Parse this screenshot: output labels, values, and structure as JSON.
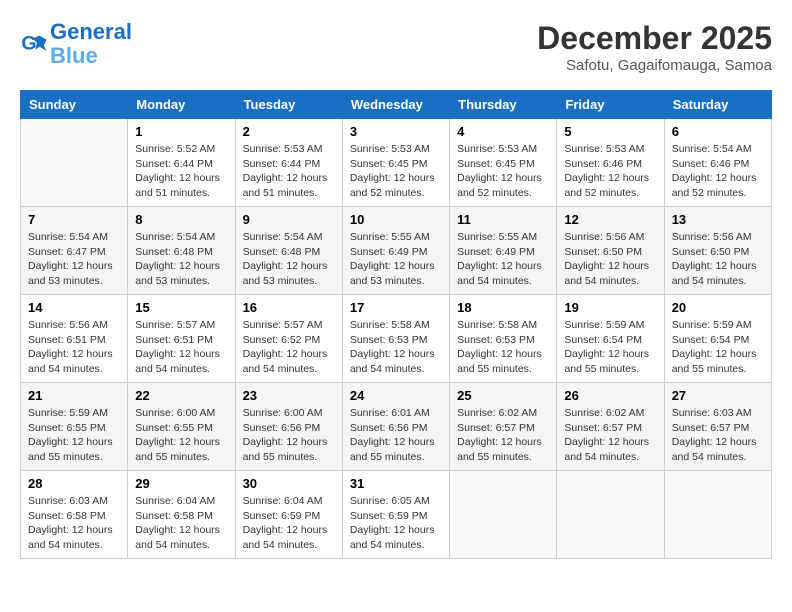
{
  "header": {
    "logo_line1": "General",
    "logo_line2": "Blue",
    "month_title": "December 2025",
    "location": "Safotu, Gagaifomauga, Samoa"
  },
  "weekdays": [
    "Sunday",
    "Monday",
    "Tuesday",
    "Wednesday",
    "Thursday",
    "Friday",
    "Saturday"
  ],
  "weeks": [
    [
      {
        "day": "",
        "empty": true
      },
      {
        "day": "1",
        "sunrise": "5:52 AM",
        "sunset": "6:44 PM",
        "daylight": "12 hours and 51 minutes."
      },
      {
        "day": "2",
        "sunrise": "5:53 AM",
        "sunset": "6:44 PM",
        "daylight": "12 hours and 51 minutes."
      },
      {
        "day": "3",
        "sunrise": "5:53 AM",
        "sunset": "6:45 PM",
        "daylight": "12 hours and 52 minutes."
      },
      {
        "day": "4",
        "sunrise": "5:53 AM",
        "sunset": "6:45 PM",
        "daylight": "12 hours and 52 minutes."
      },
      {
        "day": "5",
        "sunrise": "5:53 AM",
        "sunset": "6:46 PM",
        "daylight": "12 hours and 52 minutes."
      },
      {
        "day": "6",
        "sunrise": "5:54 AM",
        "sunset": "6:46 PM",
        "daylight": "12 hours and 52 minutes."
      }
    ],
    [
      {
        "day": "7",
        "sunrise": "5:54 AM",
        "sunset": "6:47 PM",
        "daylight": "12 hours and 53 minutes."
      },
      {
        "day": "8",
        "sunrise": "5:54 AM",
        "sunset": "6:48 PM",
        "daylight": "12 hours and 53 minutes."
      },
      {
        "day": "9",
        "sunrise": "5:54 AM",
        "sunset": "6:48 PM",
        "daylight": "12 hours and 53 minutes."
      },
      {
        "day": "10",
        "sunrise": "5:55 AM",
        "sunset": "6:49 PM",
        "daylight": "12 hours and 53 minutes."
      },
      {
        "day": "11",
        "sunrise": "5:55 AM",
        "sunset": "6:49 PM",
        "daylight": "12 hours and 54 minutes."
      },
      {
        "day": "12",
        "sunrise": "5:56 AM",
        "sunset": "6:50 PM",
        "daylight": "12 hours and 54 minutes."
      },
      {
        "day": "13",
        "sunrise": "5:56 AM",
        "sunset": "6:50 PM",
        "daylight": "12 hours and 54 minutes."
      }
    ],
    [
      {
        "day": "14",
        "sunrise": "5:56 AM",
        "sunset": "6:51 PM",
        "daylight": "12 hours and 54 minutes."
      },
      {
        "day": "15",
        "sunrise": "5:57 AM",
        "sunset": "6:51 PM",
        "daylight": "12 hours and 54 minutes."
      },
      {
        "day": "16",
        "sunrise": "5:57 AM",
        "sunset": "6:52 PM",
        "daylight": "12 hours and 54 minutes."
      },
      {
        "day": "17",
        "sunrise": "5:58 AM",
        "sunset": "6:53 PM",
        "daylight": "12 hours and 54 minutes."
      },
      {
        "day": "18",
        "sunrise": "5:58 AM",
        "sunset": "6:53 PM",
        "daylight": "12 hours and 55 minutes."
      },
      {
        "day": "19",
        "sunrise": "5:59 AM",
        "sunset": "6:54 PM",
        "daylight": "12 hours and 55 minutes."
      },
      {
        "day": "20",
        "sunrise": "5:59 AM",
        "sunset": "6:54 PM",
        "daylight": "12 hours and 55 minutes."
      }
    ],
    [
      {
        "day": "21",
        "sunrise": "5:59 AM",
        "sunset": "6:55 PM",
        "daylight": "12 hours and 55 minutes."
      },
      {
        "day": "22",
        "sunrise": "6:00 AM",
        "sunset": "6:55 PM",
        "daylight": "12 hours and 55 minutes."
      },
      {
        "day": "23",
        "sunrise": "6:00 AM",
        "sunset": "6:56 PM",
        "daylight": "12 hours and 55 minutes."
      },
      {
        "day": "24",
        "sunrise": "6:01 AM",
        "sunset": "6:56 PM",
        "daylight": "12 hours and 55 minutes."
      },
      {
        "day": "25",
        "sunrise": "6:02 AM",
        "sunset": "6:57 PM",
        "daylight": "12 hours and 55 minutes."
      },
      {
        "day": "26",
        "sunrise": "6:02 AM",
        "sunset": "6:57 PM",
        "daylight": "12 hours and 54 minutes."
      },
      {
        "day": "27",
        "sunrise": "6:03 AM",
        "sunset": "6:57 PM",
        "daylight": "12 hours and 54 minutes."
      }
    ],
    [
      {
        "day": "28",
        "sunrise": "6:03 AM",
        "sunset": "6:58 PM",
        "daylight": "12 hours and 54 minutes."
      },
      {
        "day": "29",
        "sunrise": "6:04 AM",
        "sunset": "6:58 PM",
        "daylight": "12 hours and 54 minutes."
      },
      {
        "day": "30",
        "sunrise": "6:04 AM",
        "sunset": "6:59 PM",
        "daylight": "12 hours and 54 minutes."
      },
      {
        "day": "31",
        "sunrise": "6:05 AM",
        "sunset": "6:59 PM",
        "daylight": "12 hours and 54 minutes."
      },
      {
        "day": "",
        "empty": true
      },
      {
        "day": "",
        "empty": true
      },
      {
        "day": "",
        "empty": true
      }
    ]
  ],
  "labels": {
    "sunrise_prefix": "Sunrise: ",
    "sunset_prefix": "Sunset: ",
    "daylight_prefix": "Daylight: "
  }
}
